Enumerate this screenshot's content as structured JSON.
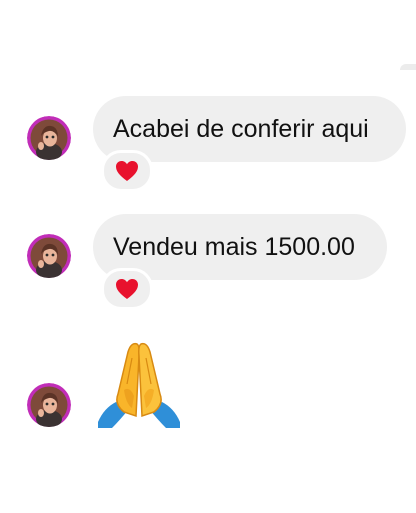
{
  "messages": [
    {
      "text": "Acabei de conferir aqui",
      "reaction_icon": "red-heart-icon"
    },
    {
      "text": "Vendeu mais 1500.00",
      "reaction_icon": "red-heart-icon"
    },
    {
      "emoji_icon": "folded-hands-icon"
    }
  ],
  "colors": {
    "bubble_bg": "#efefef",
    "text": "#111111",
    "avatar_ring": "#c12db8",
    "heart": "#e8112d",
    "hands": "#f9b52a",
    "sleeves": "#2f8fd8"
  }
}
